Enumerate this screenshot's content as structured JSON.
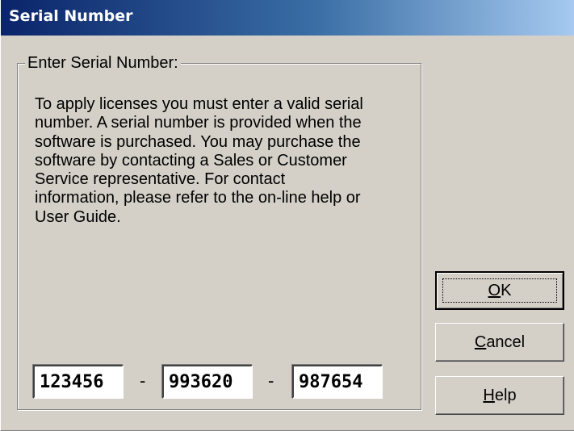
{
  "window": {
    "title": "Serial Number"
  },
  "group": {
    "legend": "Enter Serial Number:",
    "description": "To apply licenses you must enter a valid serial\nnumber. A serial number is provided when the\nsoftware is purchased. You may purchase the\nsoftware by contacting a Sales or Customer\nService representative. For contact\ninformation, please refer to the on-line help or\nUser Guide."
  },
  "serial": {
    "part1": "123456",
    "part2": "993620",
    "part3": "987654",
    "separator": "-"
  },
  "buttons": {
    "ok": {
      "mnemonic": "O",
      "rest": "K"
    },
    "cancel": {
      "mnemonic": "C",
      "rest": "ancel"
    },
    "help": {
      "mnemonic": "H",
      "rest": "elp"
    }
  },
  "colors": {
    "title_gradient_start": "#0a246a",
    "title_gradient_end": "#a6caf0",
    "dialog_face": "#d4d0c8"
  }
}
